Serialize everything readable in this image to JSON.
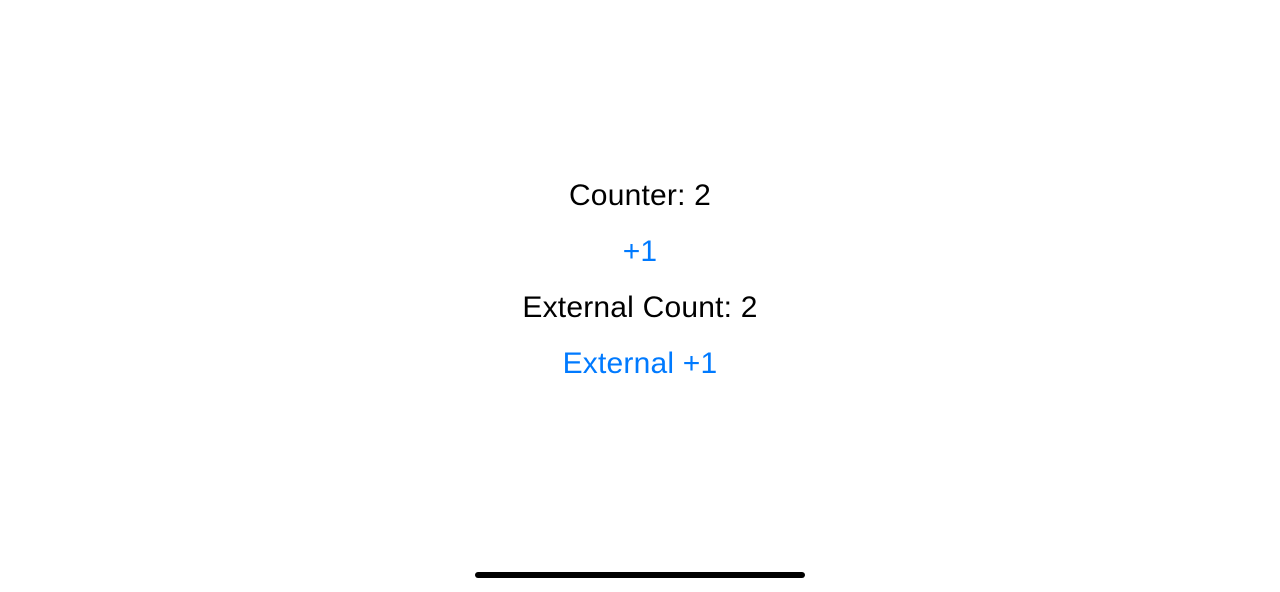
{
  "counter": {
    "label": "Counter: 2",
    "increment_button": "+1"
  },
  "external_counter": {
    "label": "External Count: 2",
    "increment_button": "External +1"
  }
}
